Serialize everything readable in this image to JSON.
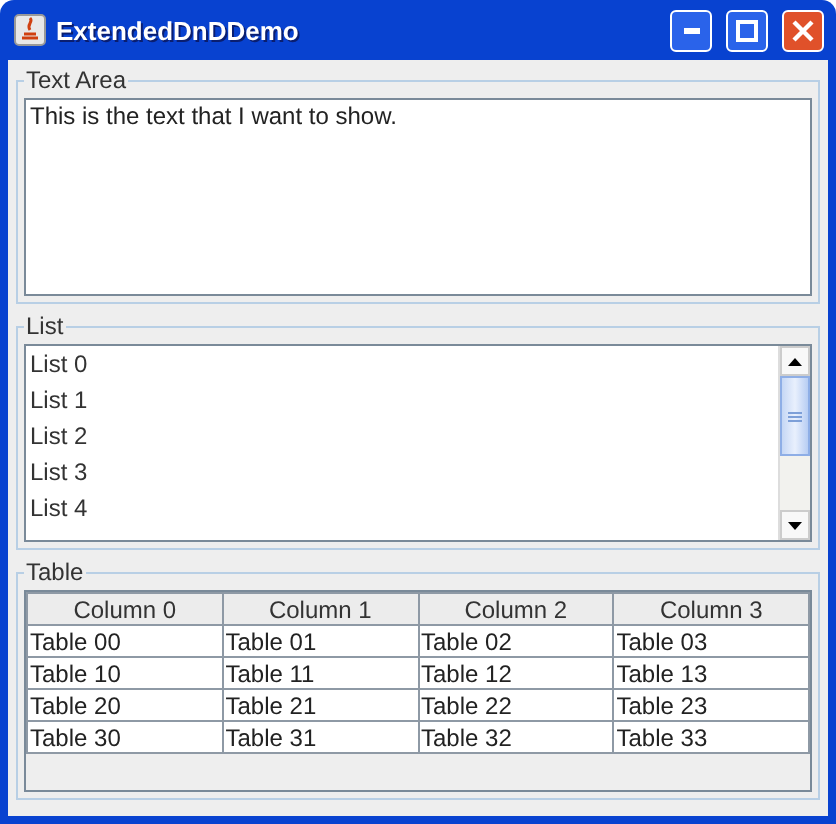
{
  "window": {
    "title": "ExtendedDnDDemo"
  },
  "text_area": {
    "title": "Text Area",
    "value": "This is the text that I want to show."
  },
  "list": {
    "title": "List",
    "items": [
      "List 0",
      "List 1",
      "List 2",
      "List 3",
      "List 4"
    ]
  },
  "table": {
    "title": "Table",
    "columns": [
      "Column 0",
      "Column 1",
      "Column 2",
      "Column 3"
    ],
    "rows": [
      [
        "Table 00",
        "Table 01",
        "Table 02",
        "Table 03"
      ],
      [
        "Table 10",
        "Table 11",
        "Table 12",
        "Table 13"
      ],
      [
        "Table 20",
        "Table 21",
        "Table 22",
        "Table 23"
      ],
      [
        "Table 30",
        "Table 31",
        "Table 32",
        "Table 33"
      ]
    ]
  }
}
